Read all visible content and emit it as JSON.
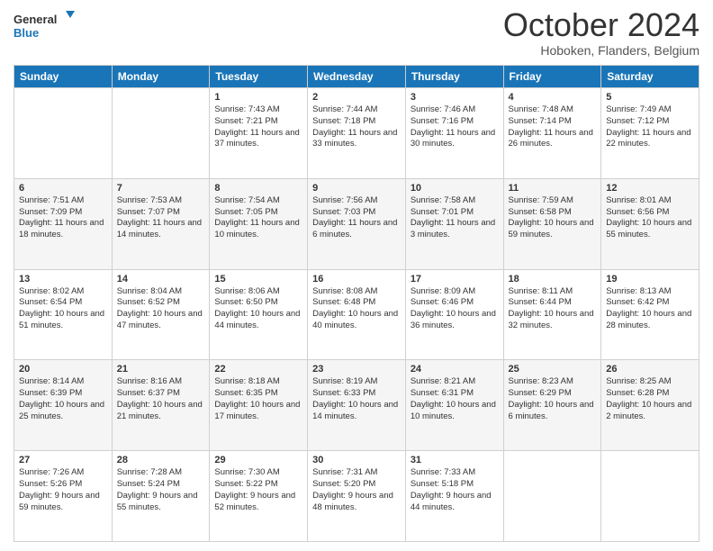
{
  "header": {
    "logo_line1": "General",
    "logo_line2": "Blue",
    "month_title": "October 2024",
    "location": "Hoboken, Flanders, Belgium"
  },
  "weekdays": [
    "Sunday",
    "Monday",
    "Tuesday",
    "Wednesday",
    "Thursday",
    "Friday",
    "Saturday"
  ],
  "weeks": [
    [
      {
        "day": "",
        "info": ""
      },
      {
        "day": "",
        "info": ""
      },
      {
        "day": "1",
        "info": "Sunrise: 7:43 AM\nSunset: 7:21 PM\nDaylight: 11 hours and 37 minutes."
      },
      {
        "day": "2",
        "info": "Sunrise: 7:44 AM\nSunset: 7:18 PM\nDaylight: 11 hours and 33 minutes."
      },
      {
        "day": "3",
        "info": "Sunrise: 7:46 AM\nSunset: 7:16 PM\nDaylight: 11 hours and 30 minutes."
      },
      {
        "day": "4",
        "info": "Sunrise: 7:48 AM\nSunset: 7:14 PM\nDaylight: 11 hours and 26 minutes."
      },
      {
        "day": "5",
        "info": "Sunrise: 7:49 AM\nSunset: 7:12 PM\nDaylight: 11 hours and 22 minutes."
      }
    ],
    [
      {
        "day": "6",
        "info": "Sunrise: 7:51 AM\nSunset: 7:09 PM\nDaylight: 11 hours and 18 minutes."
      },
      {
        "day": "7",
        "info": "Sunrise: 7:53 AM\nSunset: 7:07 PM\nDaylight: 11 hours and 14 minutes."
      },
      {
        "day": "8",
        "info": "Sunrise: 7:54 AM\nSunset: 7:05 PM\nDaylight: 11 hours and 10 minutes."
      },
      {
        "day": "9",
        "info": "Sunrise: 7:56 AM\nSunset: 7:03 PM\nDaylight: 11 hours and 6 minutes."
      },
      {
        "day": "10",
        "info": "Sunrise: 7:58 AM\nSunset: 7:01 PM\nDaylight: 11 hours and 3 minutes."
      },
      {
        "day": "11",
        "info": "Sunrise: 7:59 AM\nSunset: 6:58 PM\nDaylight: 10 hours and 59 minutes."
      },
      {
        "day": "12",
        "info": "Sunrise: 8:01 AM\nSunset: 6:56 PM\nDaylight: 10 hours and 55 minutes."
      }
    ],
    [
      {
        "day": "13",
        "info": "Sunrise: 8:02 AM\nSunset: 6:54 PM\nDaylight: 10 hours and 51 minutes."
      },
      {
        "day": "14",
        "info": "Sunrise: 8:04 AM\nSunset: 6:52 PM\nDaylight: 10 hours and 47 minutes."
      },
      {
        "day": "15",
        "info": "Sunrise: 8:06 AM\nSunset: 6:50 PM\nDaylight: 10 hours and 44 minutes."
      },
      {
        "day": "16",
        "info": "Sunrise: 8:08 AM\nSunset: 6:48 PM\nDaylight: 10 hours and 40 minutes."
      },
      {
        "day": "17",
        "info": "Sunrise: 8:09 AM\nSunset: 6:46 PM\nDaylight: 10 hours and 36 minutes."
      },
      {
        "day": "18",
        "info": "Sunrise: 8:11 AM\nSunset: 6:44 PM\nDaylight: 10 hours and 32 minutes."
      },
      {
        "day": "19",
        "info": "Sunrise: 8:13 AM\nSunset: 6:42 PM\nDaylight: 10 hours and 28 minutes."
      }
    ],
    [
      {
        "day": "20",
        "info": "Sunrise: 8:14 AM\nSunset: 6:39 PM\nDaylight: 10 hours and 25 minutes."
      },
      {
        "day": "21",
        "info": "Sunrise: 8:16 AM\nSunset: 6:37 PM\nDaylight: 10 hours and 21 minutes."
      },
      {
        "day": "22",
        "info": "Sunrise: 8:18 AM\nSunset: 6:35 PM\nDaylight: 10 hours and 17 minutes."
      },
      {
        "day": "23",
        "info": "Sunrise: 8:19 AM\nSunset: 6:33 PM\nDaylight: 10 hours and 14 minutes."
      },
      {
        "day": "24",
        "info": "Sunrise: 8:21 AM\nSunset: 6:31 PM\nDaylight: 10 hours and 10 minutes."
      },
      {
        "day": "25",
        "info": "Sunrise: 8:23 AM\nSunset: 6:29 PM\nDaylight: 10 hours and 6 minutes."
      },
      {
        "day": "26",
        "info": "Sunrise: 8:25 AM\nSunset: 6:28 PM\nDaylight: 10 hours and 2 minutes."
      }
    ],
    [
      {
        "day": "27",
        "info": "Sunrise: 7:26 AM\nSunset: 5:26 PM\nDaylight: 9 hours and 59 minutes."
      },
      {
        "day": "28",
        "info": "Sunrise: 7:28 AM\nSunset: 5:24 PM\nDaylight: 9 hours and 55 minutes."
      },
      {
        "day": "29",
        "info": "Sunrise: 7:30 AM\nSunset: 5:22 PM\nDaylight: 9 hours and 52 minutes."
      },
      {
        "day": "30",
        "info": "Sunrise: 7:31 AM\nSunset: 5:20 PM\nDaylight: 9 hours and 48 minutes."
      },
      {
        "day": "31",
        "info": "Sunrise: 7:33 AM\nSunset: 5:18 PM\nDaylight: 9 hours and 44 minutes."
      },
      {
        "day": "",
        "info": ""
      },
      {
        "day": "",
        "info": ""
      }
    ]
  ]
}
